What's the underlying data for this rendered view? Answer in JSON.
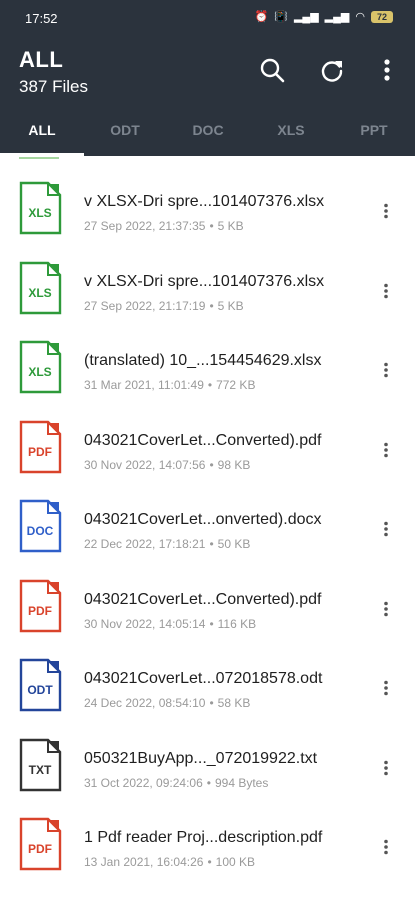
{
  "status": {
    "time": "17:52",
    "battery": "72"
  },
  "header": {
    "title": "ALL",
    "subtitle": "387 Files"
  },
  "tabs": [
    "ALL",
    "ODT",
    "DOC",
    "XLS",
    "PPT"
  ],
  "files": [
    {
      "name": "v XLSX-Dri spre...101407376.xlsx",
      "date": "27 Sep 2022, 21:37:35",
      "size": "5 KB",
      "type": "XLS",
      "color": "#2e9a3a"
    },
    {
      "name": "v XLSX-Dri spre...101407376.xlsx",
      "date": "27 Sep 2022, 21:17:19",
      "size": "5 KB",
      "type": "XLS",
      "color": "#2e9a3a"
    },
    {
      "name": "(translated) 10_...154454629.xlsx",
      "date": "31 Mar 2021, 11:01:49",
      "size": "772 KB",
      "type": "XLS",
      "color": "#2e9a3a"
    },
    {
      "name": "043021CoverLet...Converted).pdf",
      "date": "30 Nov 2022, 14:07:56",
      "size": "98 KB",
      "type": "PDF",
      "color": "#d9432b"
    },
    {
      "name": "043021CoverLet...onverted).docx",
      "date": "22 Dec 2022, 17:18:21",
      "size": "50 KB",
      "type": "DOC",
      "color": "#2f5fc9"
    },
    {
      "name": "043021CoverLet...Converted).pdf",
      "date": "30 Nov 2022, 14:05:14",
      "size": "116 KB",
      "type": "PDF",
      "color": "#d9432b"
    },
    {
      "name": "043021CoverLet...072018578.odt",
      "date": "24 Dec 2022, 08:54:10",
      "size": "58 KB",
      "type": "ODT",
      "color": "#23459a"
    },
    {
      "name": "050321BuyApp..._072019922.txt",
      "date": "31 Oct 2022, 09:24:06",
      "size": "994 Bytes",
      "type": "TXT",
      "color": "#333333"
    },
    {
      "name": "1 Pdf reader Proj...description.pdf",
      "date": "13 Jan 2021, 16:04:26",
      "size": "100 KB",
      "type": "PDF",
      "color": "#d9432b"
    }
  ]
}
